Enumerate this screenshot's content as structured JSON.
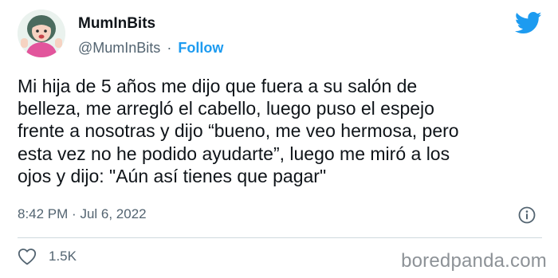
{
  "author": {
    "display_name": "MumInBits",
    "handle": "@MumInBits",
    "separator": "·",
    "follow_label": "Follow"
  },
  "tweet": {
    "text": "Mi hija de 5 años me dijo que fuera a su salón de\nbelleza, me arregló el cabello, luego puso el espejo\nfrente a nosotras y dijo “bueno, me veo hermosa, pero\nesta vez no he podido ayudarte”, luego me miró a los\nojos y dijo: \"Aún así tienes que pagar\"",
    "time": "8:42 PM",
    "date_separator": "·",
    "date": "Jul 6, 2022",
    "like_count": "1.5K"
  },
  "watermark": "boredpanda.com",
  "colors": {
    "accent": "#1d9bf0",
    "secondary_text": "#536471",
    "primary_text": "#0f1419",
    "divider": "#cfd9de",
    "avatar_hair": "#4a6b5e",
    "avatar_shirt": "#e2559c"
  },
  "icons": [
    "avatar-illustration",
    "twitter-bird-icon",
    "info-icon",
    "heart-icon"
  ]
}
